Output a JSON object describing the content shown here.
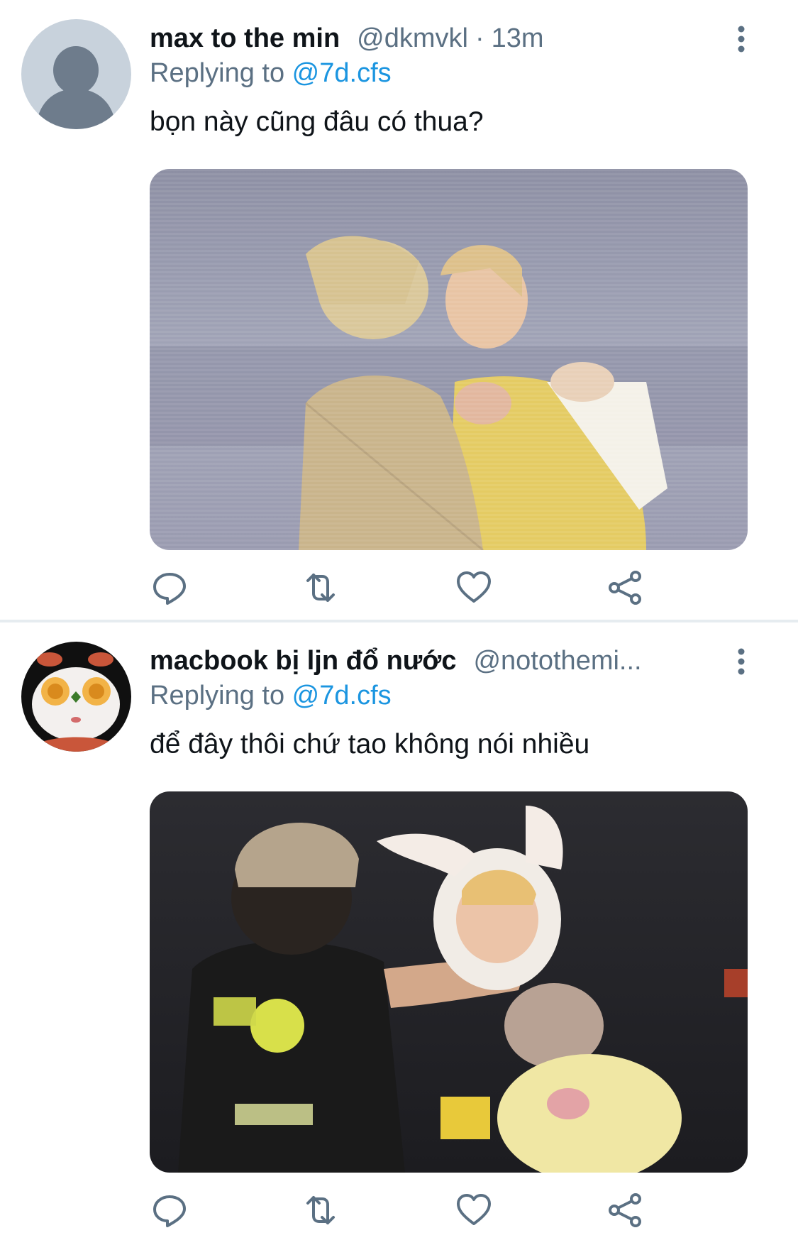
{
  "tweets": [
    {
      "display_name": "max to the min",
      "handle": "@dkmvkl",
      "separator": "·",
      "time": "13m",
      "replying_prefix": "Replying to ",
      "replying_to": "@7d.cfs",
      "text": "bọn này cũng đâu có thua?",
      "avatar_icon": "default-profile-icon",
      "media_description": "photo"
    },
    {
      "display_name": "macbook bị ljn đổ nước",
      "handle": "@notothemi...",
      "replying_prefix": "Replying to ",
      "replying_to": "@7d.cfs",
      "text": "để đây thôi chứ tao không nói nhiều",
      "avatar_icon": "cartoon-face-avatar",
      "media_description": "photo"
    }
  ],
  "actions": {
    "icons": [
      "reply-icon",
      "retweet-icon",
      "like-icon",
      "share-icon"
    ]
  },
  "colors": {
    "text_primary": "#0f1419",
    "text_secondary": "#5b7083",
    "mention": "#1b95e0",
    "divider": "#e6ecf0"
  }
}
